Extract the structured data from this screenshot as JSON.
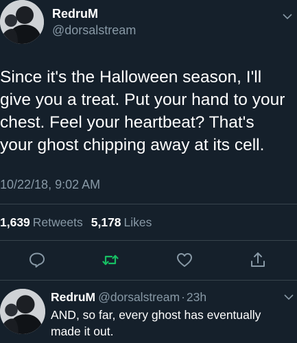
{
  "main_tweet": {
    "author_name": "RedruM",
    "author_handle": "@dorsalstream",
    "text_lines": [
      "Since it's the Halloween season, I'll",
      "give you a treat. Put your hand to your",
      "chest. Feel your heartbeat? That's",
      "your ghost chipping away at its cell."
    ],
    "timestamp": "10/22/18, 9:02 AM",
    "retweets_count": "1,639",
    "retweets_label": "Retweets",
    "likes_count": "5,178",
    "likes_label": "Likes"
  },
  "actions": {
    "reply_icon": "speech-bubble",
    "retweet_icon": "retweet-arrows",
    "like_icon": "heart",
    "share_icon": "share-upload"
  },
  "reply_tweet": {
    "author_name": "RedruM",
    "author_handle": "@dorsalstream",
    "separator": "·",
    "time": "23h",
    "text_lines": [
      "AND, so far, every ghost has eventually",
      "made it out."
    ]
  },
  "colors": {
    "background": "#15202b",
    "text_primary": "#ffffff",
    "text_secondary": "#8899a6",
    "divider": "#38444d",
    "retweet_green": "#17bf63"
  }
}
